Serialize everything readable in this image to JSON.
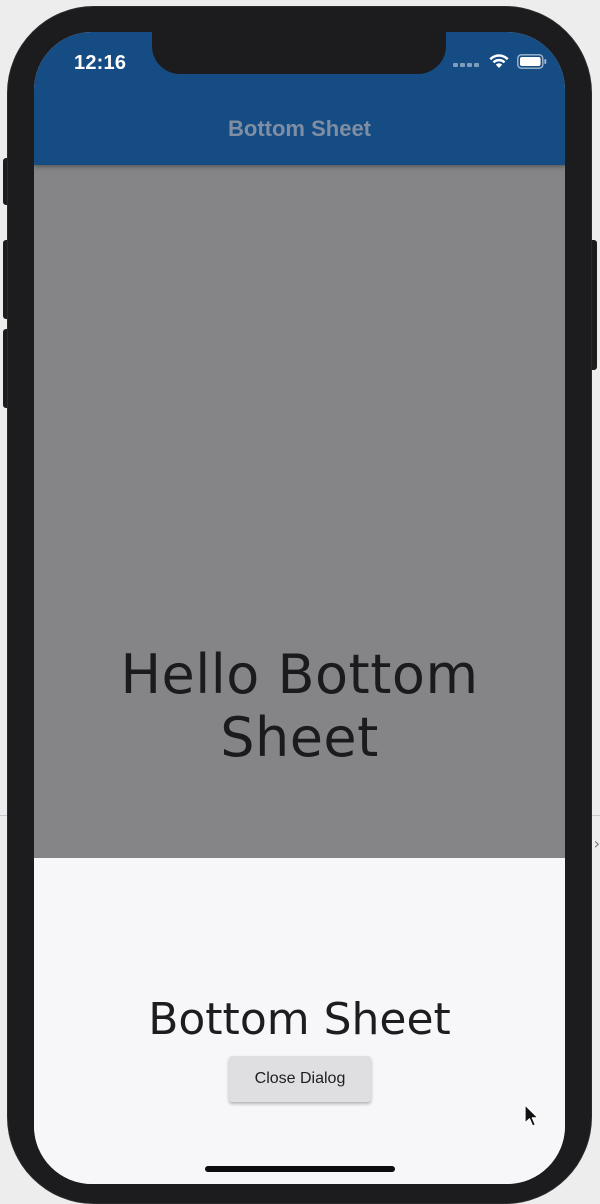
{
  "status_bar": {
    "time": "12:16",
    "wifi_icon": "wifi-icon",
    "battery_icon": "battery-icon",
    "signal_icon": "signal-dots-icon"
  },
  "app_bar": {
    "title": "Bottom Sheet",
    "color": "#154c84"
  },
  "main": {
    "message": "Hello Bottom Sheet",
    "overlay_color": "#858487"
  },
  "bottom_sheet": {
    "title": "Bottom Sheet",
    "close_button_label": "Close Dialog"
  }
}
